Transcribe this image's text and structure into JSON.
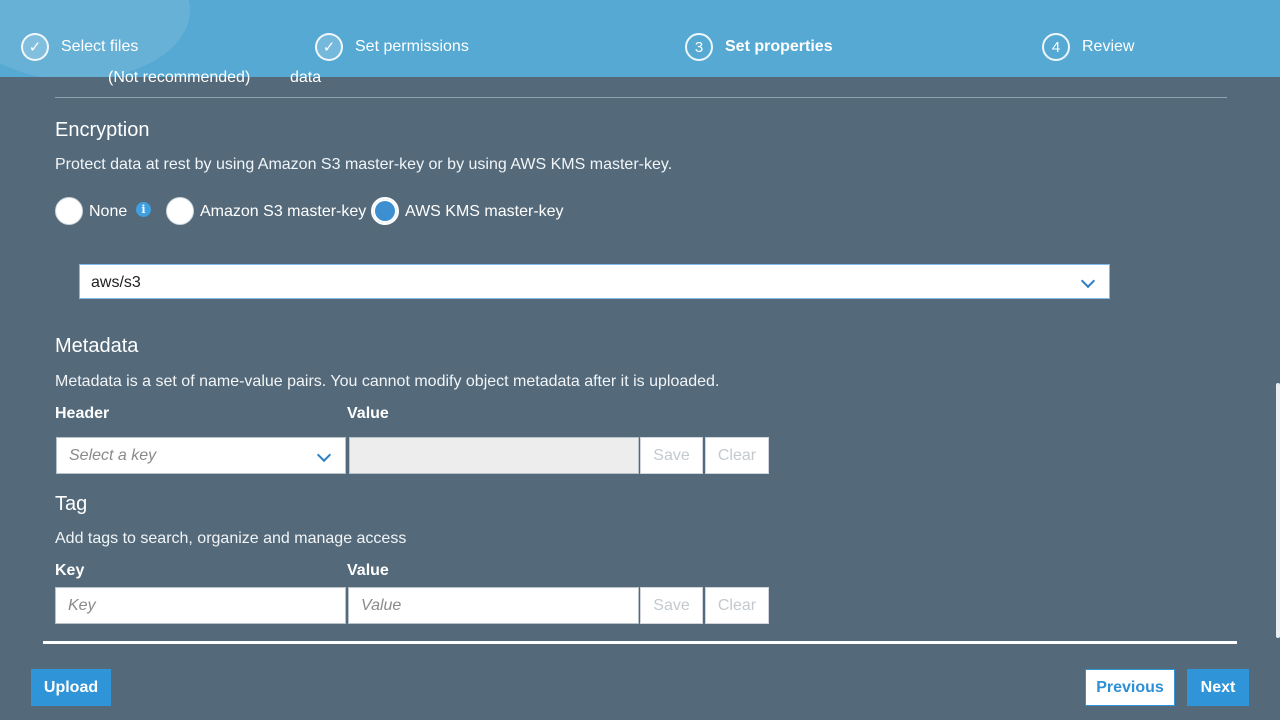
{
  "steps": [
    {
      "label": "Select files",
      "marker": "✓",
      "state": "done"
    },
    {
      "label": "Set permissions",
      "marker": "✓",
      "state": "done"
    },
    {
      "label": "Set properties",
      "marker": "3",
      "state": "active"
    },
    {
      "label": "Review",
      "marker": "4",
      "state": "pending"
    }
  ],
  "cutoff": {
    "left": "(Not recommended)",
    "right": "data"
  },
  "encryption": {
    "title": "Encryption",
    "description": "Protect data at rest by using Amazon S3 master-key or by using AWS KMS master-key.",
    "options": [
      {
        "label": "None",
        "selected": false
      },
      {
        "label": "Amazon S3 master-key",
        "selected": false
      },
      {
        "label": "AWS KMS master-key",
        "selected": true
      }
    ],
    "info_glyph": "i",
    "key_value": "aws/s3"
  },
  "metadata": {
    "title": "Metadata",
    "description": "Metadata is a set of name-value pairs. You cannot modify object metadata after it is uploaded.",
    "header_label": "Header",
    "value_label": "Value",
    "key_placeholder": "Select a key",
    "save_label": "Save",
    "clear_label": "Clear"
  },
  "tag": {
    "title": "Tag",
    "description": "Add tags to search, organize and manage access",
    "key_label": "Key",
    "value_label": "Value",
    "key_placeholder": "Key",
    "value_placeholder": "Value",
    "save_label": "Save",
    "clear_label": "Clear"
  },
  "footer": {
    "upload_label": "Upload",
    "previous_label": "Previous",
    "next_label": "Next"
  },
  "colors": {
    "background": "#546979",
    "stepper": "#56a9d3",
    "primary": "#2f95d8"
  },
  "icons": [
    "checkmark-icon",
    "info-icon",
    "chevron-down-icon"
  ]
}
